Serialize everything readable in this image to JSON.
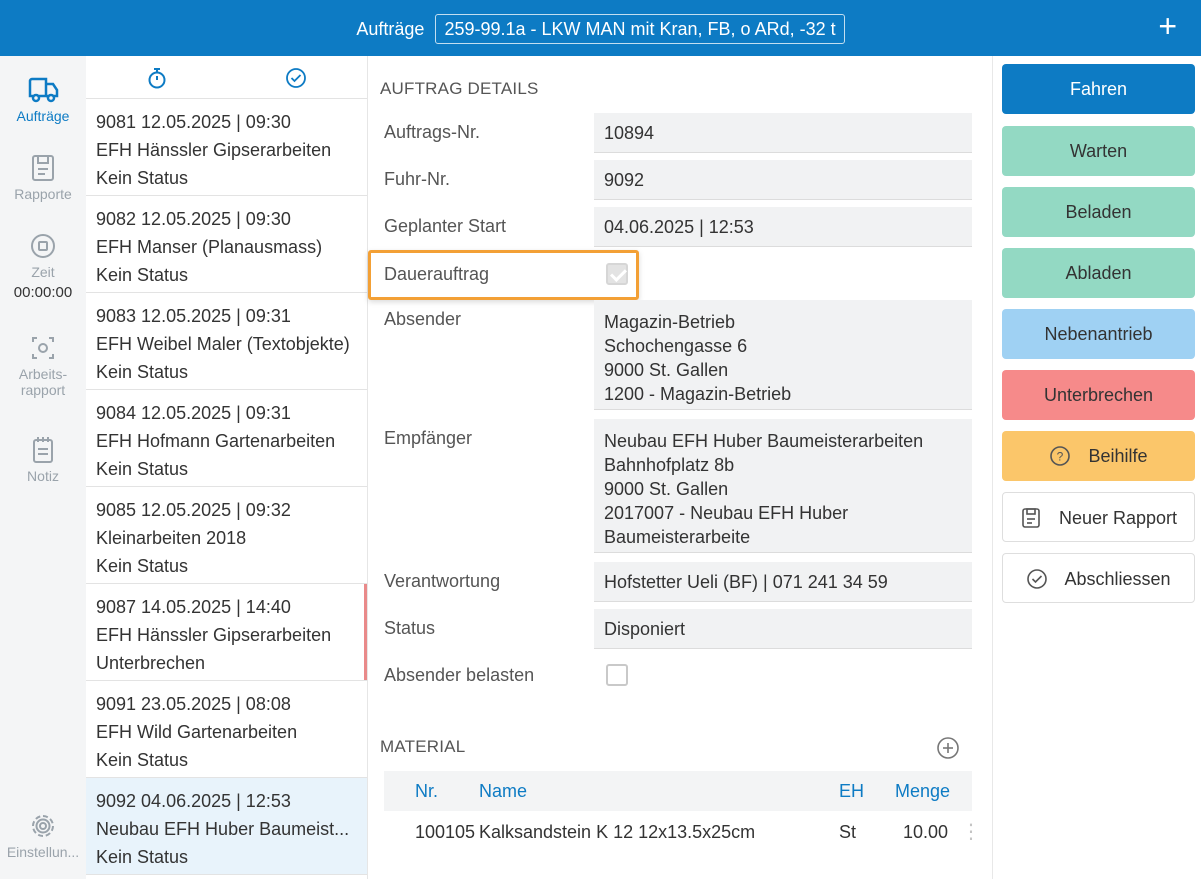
{
  "header": {
    "title": "Aufträge",
    "vehicle": "259-99.1a - LKW MAN mit Kran, FB, o ARd, -32 t",
    "add_label": "+"
  },
  "nav": {
    "auftraege": "Aufträge",
    "rapporte": "Rapporte",
    "zeit": "Zeit",
    "zeit_value": "00:00:00",
    "arbeitsrapport_line1": "Arbeits-",
    "arbeitsrapport_line2": "rapport",
    "notiz": "Notiz",
    "einstellungen": "Einstellun..."
  },
  "orders": [
    {
      "line1": "9081  12.05.2025 | 09:30",
      "line2": "EFH Hänssler Gipserarbeiten",
      "line3": "Kein Status"
    },
    {
      "line1": "9082  12.05.2025 | 09:30",
      "line2": "EFH Manser (Planausmass)",
      "line3": "Kein Status"
    },
    {
      "line1": "9083  12.05.2025 | 09:31",
      "line2": "EFH Weibel Maler (Textobjekte)",
      "line3": "Kein Status"
    },
    {
      "line1": "9084  12.05.2025 | 09:31",
      "line2": "EFH Hofmann Gartenarbeiten",
      "line3": "Kein Status"
    },
    {
      "line1": "9085  12.05.2025 | 09:32",
      "line2": "Kleinarbeiten 2018",
      "line3": "Kein Status"
    },
    {
      "line1": "9087  14.05.2025 | 14:40",
      "line2": "EFH Hänssler Gipserarbeiten",
      "line3": "Unterbrechen"
    },
    {
      "line1": "9091  23.05.2025 | 08:08",
      "line2": "EFH Wild Gartenarbeiten",
      "line3": "Kein Status"
    },
    {
      "line1": "9092  04.06.2025 | 12:53",
      "line2": "Neubau EFH Huber Baumeist...",
      "line3": "Kein Status"
    }
  ],
  "details": {
    "section_title": "AUFTRAG DETAILS",
    "auftrags_nr_label": "Auftrags-Nr.",
    "auftrags_nr": "10894",
    "fuhr_nr_label": "Fuhr-Nr.",
    "fuhr_nr": "9092",
    "start_label": "Geplanter Start",
    "start": "04.06.2025 | 12:53",
    "dauerauftrag_label": "Dauerauftrag",
    "dauerauftrag_checked": true,
    "absender_label": "Absender",
    "absender": [
      "Magazin-Betrieb",
      "Schochengasse 6",
      "9000 St. Gallen",
      "1200 - Magazin-Betrieb"
    ],
    "empfaenger_label": "Empfänger",
    "empfaenger": [
      "Neubau EFH Huber Baumeisterarbeiten",
      "Bahnhofplatz 8b",
      "9000 St. Gallen",
      "2017007 - Neubau EFH Huber",
      "Baumeisterarbeite"
    ],
    "verantwortung_label": "Verantwortung",
    "verantwortung": "Hofstetter Ueli (BF) | 071 241 34 59",
    "status_label": "Status",
    "status": "Disponiert",
    "absender_belasten_label": "Absender belasten",
    "absender_belasten_checked": false
  },
  "material": {
    "title": "MATERIAL",
    "headers": {
      "nr": "Nr.",
      "name": "Name",
      "eh": "EH",
      "menge": "Menge"
    },
    "rows": [
      {
        "nr": "100105",
        "name": "Kalksandstein K 12 12x13.5x25cm",
        "eh": "St",
        "menge": "10.00"
      }
    ]
  },
  "actions": {
    "fahren": "Fahren",
    "warten": "Warten",
    "beladen": "Beladen",
    "abladen": "Abladen",
    "nebenantrieb": "Nebenantrieb",
    "unterbrechen": "Unterbrechen",
    "beihilfe": "Beihilfe",
    "neuer_rapport": "Neuer Rapport",
    "abschliessen": "Abschliessen"
  },
  "colors": {
    "brand": "#0d7bc4",
    "teal": "#93d9c3",
    "light_blue": "#9fd1f3",
    "red": "#f68a8a",
    "orange": "#fbc66a",
    "highlight": "#f3a035",
    "status_mark": "#e98a8a"
  }
}
